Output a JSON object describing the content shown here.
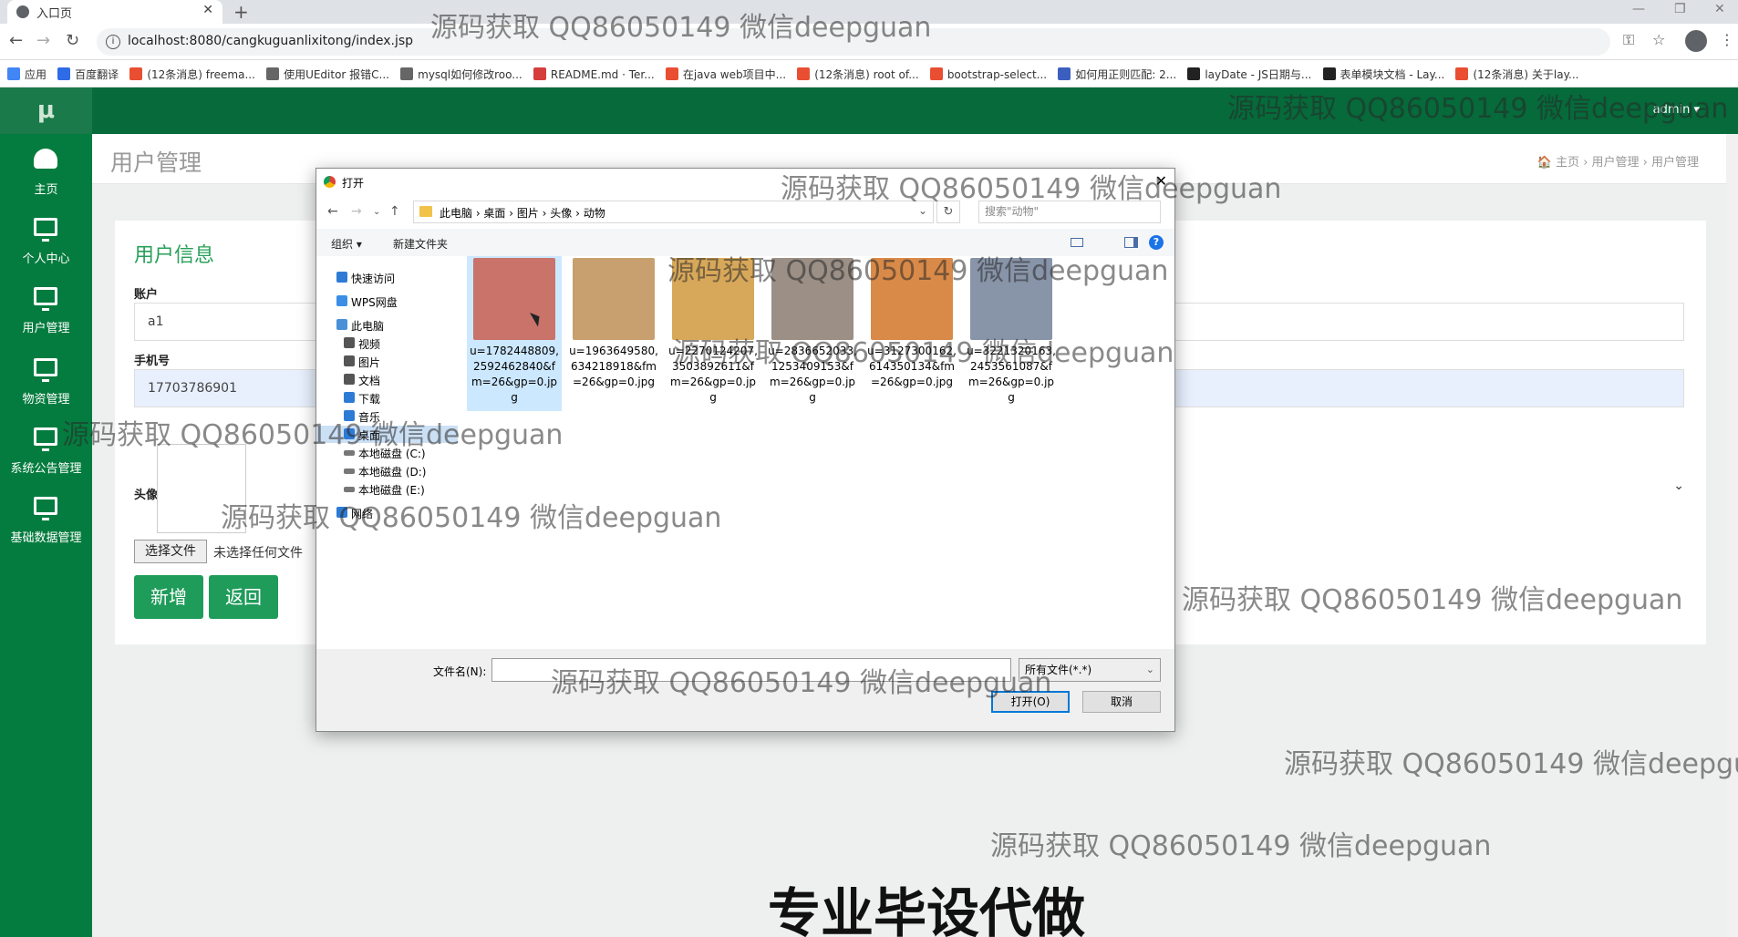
{
  "browser": {
    "tab_title": "入口页",
    "new_tab": "+",
    "url": "localhost:8080/cangkuguanlixitong/index.jsp",
    "bookmarks": [
      {
        "label": "应用",
        "color": "#4285f4"
      },
      {
        "label": "百度翻译",
        "color": "#2e6be6"
      },
      {
        "label": "(12条消息) freema...",
        "color": "#e94e32"
      },
      {
        "label": "使用UEditor 报错C...",
        "color": "#666666"
      },
      {
        "label": "mysql如何修改roo...",
        "color": "#666666"
      },
      {
        "label": "README.md · Ter...",
        "color": "#d63d3d"
      },
      {
        "label": "在java web项目中...",
        "color": "#e94e32"
      },
      {
        "label": "(12条消息) root of...",
        "color": "#e94e32"
      },
      {
        "label": "bootstrap-select...",
        "color": "#e94e32"
      },
      {
        "label": "如何用正则匹配: 2...",
        "color": "#3c5fbf"
      },
      {
        "label": "layDate - JS日期与...",
        "color": "#222222"
      },
      {
        "label": "表单模块文档 - Lay...",
        "color": "#222222"
      },
      {
        "label": "(12条消息) 关于lay...",
        "color": "#e94e32"
      }
    ]
  },
  "app": {
    "logo": "μ",
    "user_menu": "admin ▾",
    "sidebar": [
      {
        "label": "主页",
        "icon": "dashboard-icon"
      },
      {
        "label": "个人中心",
        "icon": "monitor-icon"
      },
      {
        "label": "用户管理",
        "icon": "monitor-icon"
      },
      {
        "label": "物资管理",
        "icon": "monitor-icon"
      },
      {
        "label": "系统公告管理",
        "icon": "monitor-icon"
      },
      {
        "label": "基础数据管理",
        "icon": "monitor-icon"
      }
    ],
    "page_title": "用户管理",
    "breadcrumb": "🏠 主页  ›  用户管理  ›  用户管理",
    "card_title": "用户信息",
    "fields": {
      "account_label": "账户",
      "account_value": "a1",
      "phone_label": "手机号",
      "phone_value": "17703786901",
      "avatar_label": "头像",
      "choose_file": "选择文件",
      "no_file": "未选择任何文件"
    },
    "buttons": {
      "add": "新增",
      "back": "返回"
    }
  },
  "dialog": {
    "title": "打开",
    "path": "此电脑  ›  桌面  ›  图片  ›  头像  ›  动物",
    "search_placeholder": "搜索\"动物\"",
    "organize": "组织 ▾",
    "new_folder": "新建文件夹",
    "tree": [
      {
        "label": "快速访问",
        "color": "#2e7bd6"
      },
      {
        "label": "WPS网盘",
        "color": "#3a8ee6"
      },
      {
        "label": "此电脑",
        "color": "#4a90d9"
      },
      {
        "label": "视频",
        "color": "#555555"
      },
      {
        "label": "图片",
        "color": "#555555"
      },
      {
        "label": "文档",
        "color": "#555555"
      },
      {
        "label": "下载",
        "color": "#2e7bd6"
      },
      {
        "label": "音乐",
        "color": "#2e7bd6"
      },
      {
        "label": "桌面",
        "color": "#2e7bd6"
      },
      {
        "label": "本地磁盘 (C:)",
        "color": "#777777"
      },
      {
        "label": "本地磁盘 (D:)",
        "color": "#777777"
      },
      {
        "label": "本地磁盘 (E:)",
        "color": "#777777"
      },
      {
        "label": "网络",
        "color": "#2e7bd6"
      }
    ],
    "files": [
      {
        "name": "u=1782448809,2592462840&fm=26&gp=0.jpg",
        "color": "#c9736a"
      },
      {
        "name": "u=1963649580,634218918&fm=26&gp=0.jpg",
        "color": "#c8a070"
      },
      {
        "name": "u=2270124207,3503892611&fm=26&gp=0.jpg",
        "color": "#d8a85a"
      },
      {
        "name": "u=2836652033,1253409153&fm=26&gp=0.jpg",
        "color": "#9b8f86"
      },
      {
        "name": "u=3127300162,614350134&fm=26&gp=0.jpg",
        "color": "#d98a48"
      },
      {
        "name": "u=3221320163,2453561087&fm=26&gp=0.jpg",
        "color": "#8894a8"
      }
    ],
    "filename_label": "文件名(N):",
    "filetype": "所有文件(*.*)",
    "open_button": "打开(O)",
    "cancel_button": "取消"
  },
  "overlay": {
    "watermark": "源码获取 QQ86050149 微信deepguan",
    "banner": "专业毕设代做"
  }
}
